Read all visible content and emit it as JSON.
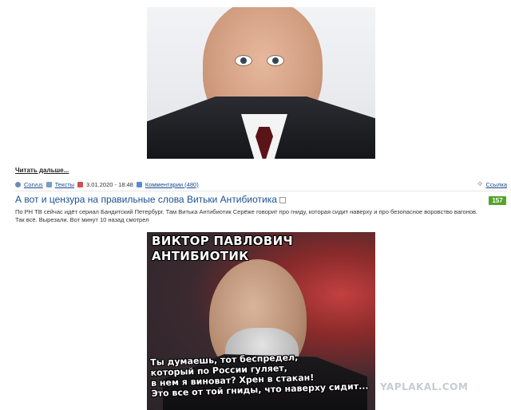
{
  "post_prev": {
    "read_more": "Читать дальше...",
    "meta": {
      "author": "Corvus",
      "category": "Тексты",
      "date": "3.01.2020 - 18:48",
      "comments": "Комментарии (480)",
      "link": "Ссылка"
    }
  },
  "post": {
    "title": "А вот и цензура на правильные слова Витьки Антибиотика",
    "rating": "157",
    "text_line1": "По РН ТВ сейчас идёт сериал Бандитский Петербург. Там Витька Антибиотик Серёже говорит про гниду, которая сидит наверху и про безопасное воровство вагонов.",
    "text_line2": "Так всё. Вырезали. Вот минут 10 назад смотрел",
    "image": {
      "heading_line1": "ВИКТОР ПАВЛОВИЧ",
      "heading_line2": "АНТИБИОТИК",
      "caption_lines": [
        "Ты думаешь, тот беспредел,",
        "который по России гуляет,",
        "в нем я виноват? Хрен в стакан!",
        "Это все от той гниды, что наверху сидит..."
      ]
    }
  },
  "watermark": "YAPLAKAL.COM"
}
